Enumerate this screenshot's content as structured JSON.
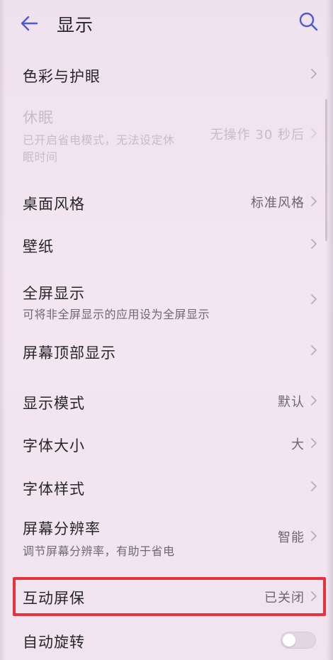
{
  "header": {
    "title": "显示"
  },
  "rows": [
    {
      "label": "色彩与护眼",
      "value": "",
      "sub": ""
    },
    {
      "label": "休眠",
      "sub1": "已开启省电模式，无法设定休",
      "sub2": "眠时间",
      "value": "无操作 30 秒后"
    },
    {
      "label": "桌面风格",
      "value": "标准风格"
    },
    {
      "label": "壁纸",
      "value": ""
    },
    {
      "label": "全屏显示",
      "sub": "可将非全屏显示的应用设为全屏显示",
      "value": ""
    },
    {
      "label": "屏幕顶部显示",
      "value": ""
    },
    {
      "label": "显示模式",
      "value": "默认"
    },
    {
      "label": "字体大小",
      "value": "大"
    },
    {
      "label": "字体样式",
      "value": ""
    },
    {
      "label": "屏幕分辨率",
      "sub": "调节屏幕分辨率，有助于省电",
      "value": "智能"
    },
    {
      "label": "互动屏保",
      "value": "已关闭"
    },
    {
      "label": "自动旋转",
      "toggle_on": false
    }
  ],
  "colors": {
    "accent": "#4a5bd0",
    "highlight": "#e8323e"
  }
}
